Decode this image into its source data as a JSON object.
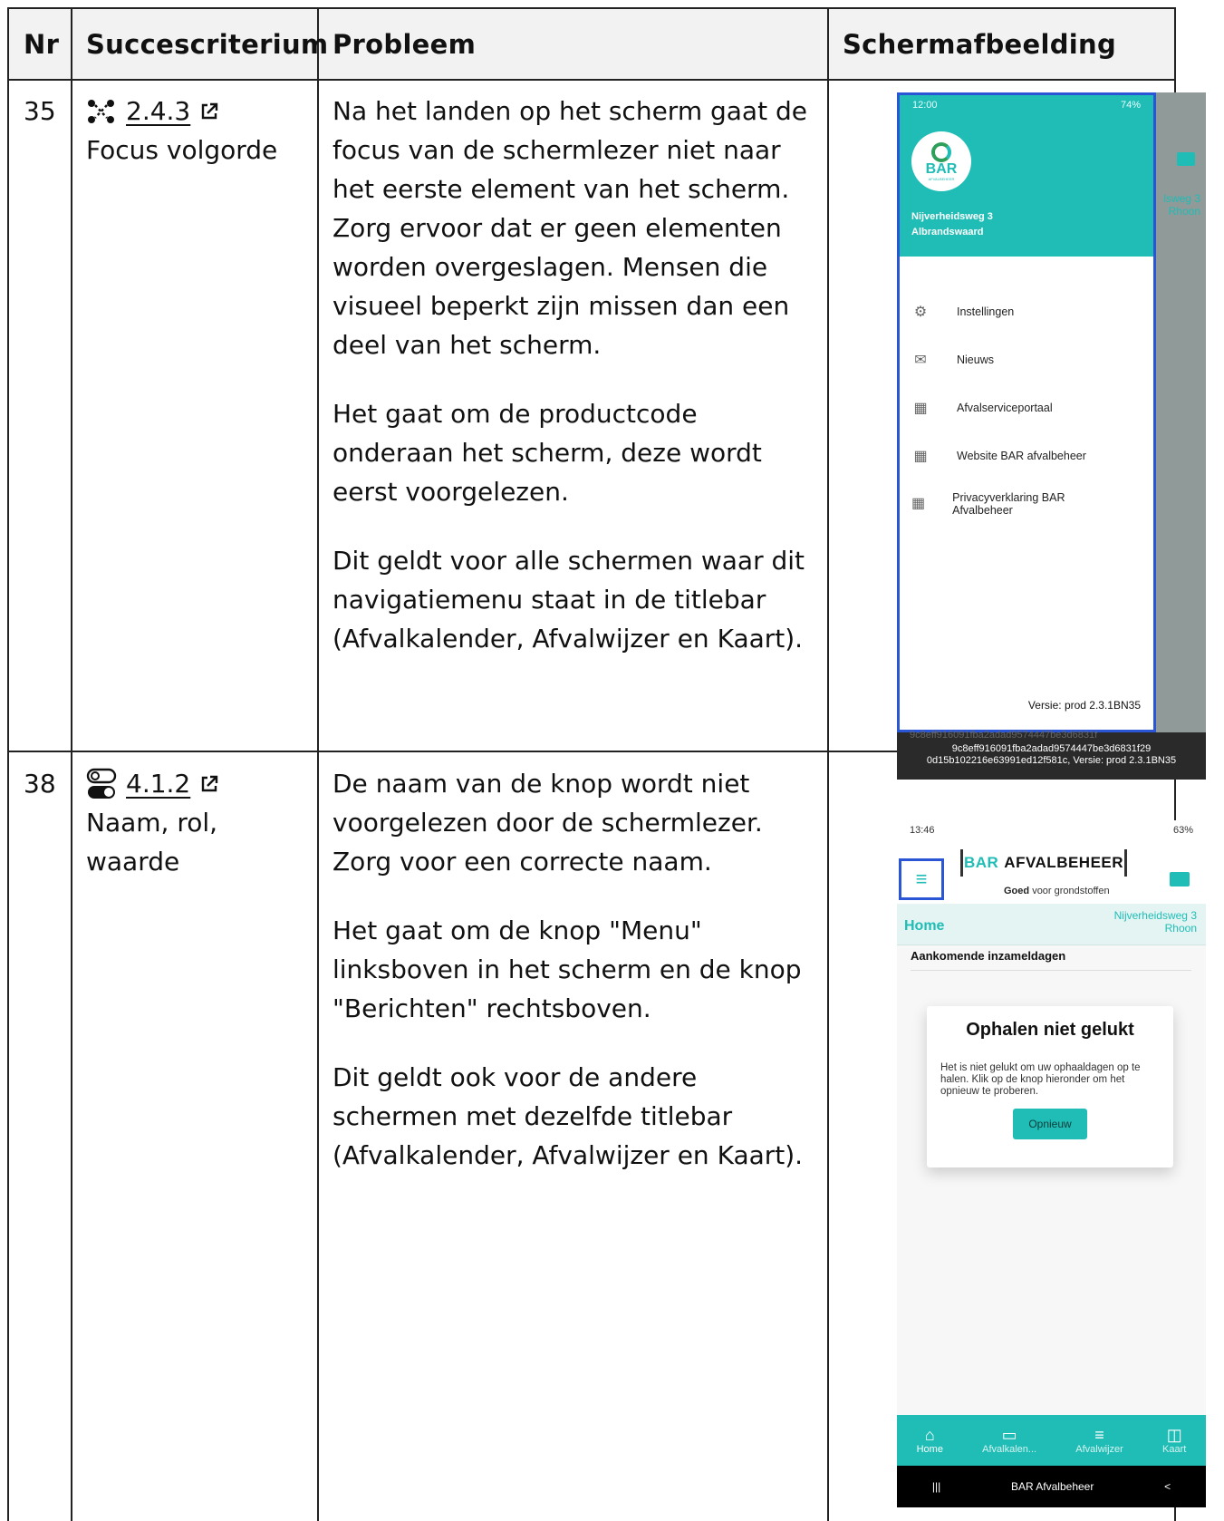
{
  "headers": {
    "nr": "Nr",
    "succes": "Succescriterium",
    "probleem": "Probleem",
    "schermafbeelding": "Schermafbeelding"
  },
  "rows": [
    {
      "nr": "35",
      "criterion_icon": "focus-order-icon",
      "criterion_number": "2.4.3",
      "criterion_name": "Focus volgorde",
      "paragraphs": [
        "Na het landen op het scherm gaat de focus van de schermlezer niet naar het eerste element van het scherm. Zorg ervoor dat er geen elementen worden overgeslagen. Mensen die visueel beperkt zijn missen dan een deel van het scherm.",
        "Het gaat om de productcode onderaan het scherm, deze wordt eerst voorgelezen.",
        "Dit geldt voor alle schermen waar dit navigatiemenu staat in de titlebar (Afvalkalender, Afvalwijzer en Kaart)."
      ],
      "screenshot": {
        "status_time": "12:00",
        "status_right": "74%",
        "logo_text": "BAR",
        "logo_sub": "AFVALBEHEER",
        "address_line1": "Nijverheidsweg 3",
        "address_line2": "Albrandswaard",
        "ghost_address_line1": "lsweg 3",
        "ghost_address_line2": "Rhoon",
        "menu": [
          {
            "icon": "gear-icon",
            "glyph": "⚙",
            "label": "Instellingen"
          },
          {
            "icon": "mail-icon",
            "glyph": "✉",
            "label": "Nieuws"
          },
          {
            "icon": "grid-icon",
            "glyph": "▦",
            "label": "Afvalserviceportaal"
          },
          {
            "icon": "grid-icon",
            "glyph": "▦",
            "label": "Website BAR afvalbeheer"
          },
          {
            "icon": "grid-icon",
            "glyph": "▦",
            "label": "Privacyverklaring BAR Afvalbeheer"
          }
        ],
        "versie": "Versie:  prod 2.3.1BN35",
        "tooltip_faded": "9c8eff916091fba2adad9574447be3d6831f",
        "tooltip": "9c8eff916091fba2adad9574447be3d6831f29 0d15b102216e63991ed12f581c, Versie:  prod 2.3.1BN35"
      }
    },
    {
      "nr": "38",
      "criterion_icon": "toggle-icon",
      "criterion_number": "4.1.2",
      "criterion_name": "Naam, rol, waarde",
      "paragraphs": [
        "De naam van de knop wordt niet voorgelezen door de schermlezer. Zorg voor een correcte naam.",
        "Het gaat om de knop \"Menu\" linksboven in het scherm en de knop \"Berichten\" rechtsboven.",
        "Dit geldt ook voor de andere schermen met dezelfde titlebar (Afvalkalender, Afvalwijzer en Kaart)."
      ],
      "screenshot": {
        "status_time": "13:46",
        "status_right": "63%",
        "brand_part1": "BAR",
        "brand_part2": "AFVALBEHEER",
        "tagline_bold": "Goed",
        "tagline_rest": "voor grondstoffen",
        "home_label": "Home",
        "address_line1": "Nijverheidsweg 3",
        "address_line2": "Rhoon",
        "upcoming": "Aankomende inzameldagen",
        "card_title": "Ophalen niet gelukt",
        "card_text": "Het is niet gelukt om uw ophaaldagen op te halen. Klik op de knop hieronder om het opnieuw te proberen.",
        "card_button": "Opnieuw",
        "nav": [
          {
            "icon": "home-icon",
            "glyph": "⌂",
            "label": "Home"
          },
          {
            "icon": "calendar-icon",
            "glyph": "▭",
            "label": "Afvalkalen..."
          },
          {
            "icon": "search-list-icon",
            "glyph": "≡",
            "label": "Afvalwijzer"
          },
          {
            "icon": "map-icon",
            "glyph": "◫",
            "label": "Kaart"
          }
        ],
        "sysbar_label": "BAR Afvalbeheer"
      }
    }
  ],
  "colors": {
    "teal": "#1fbdb5",
    "focus_outline": "#2a56d6",
    "header_bg": "#f2f2f2"
  }
}
